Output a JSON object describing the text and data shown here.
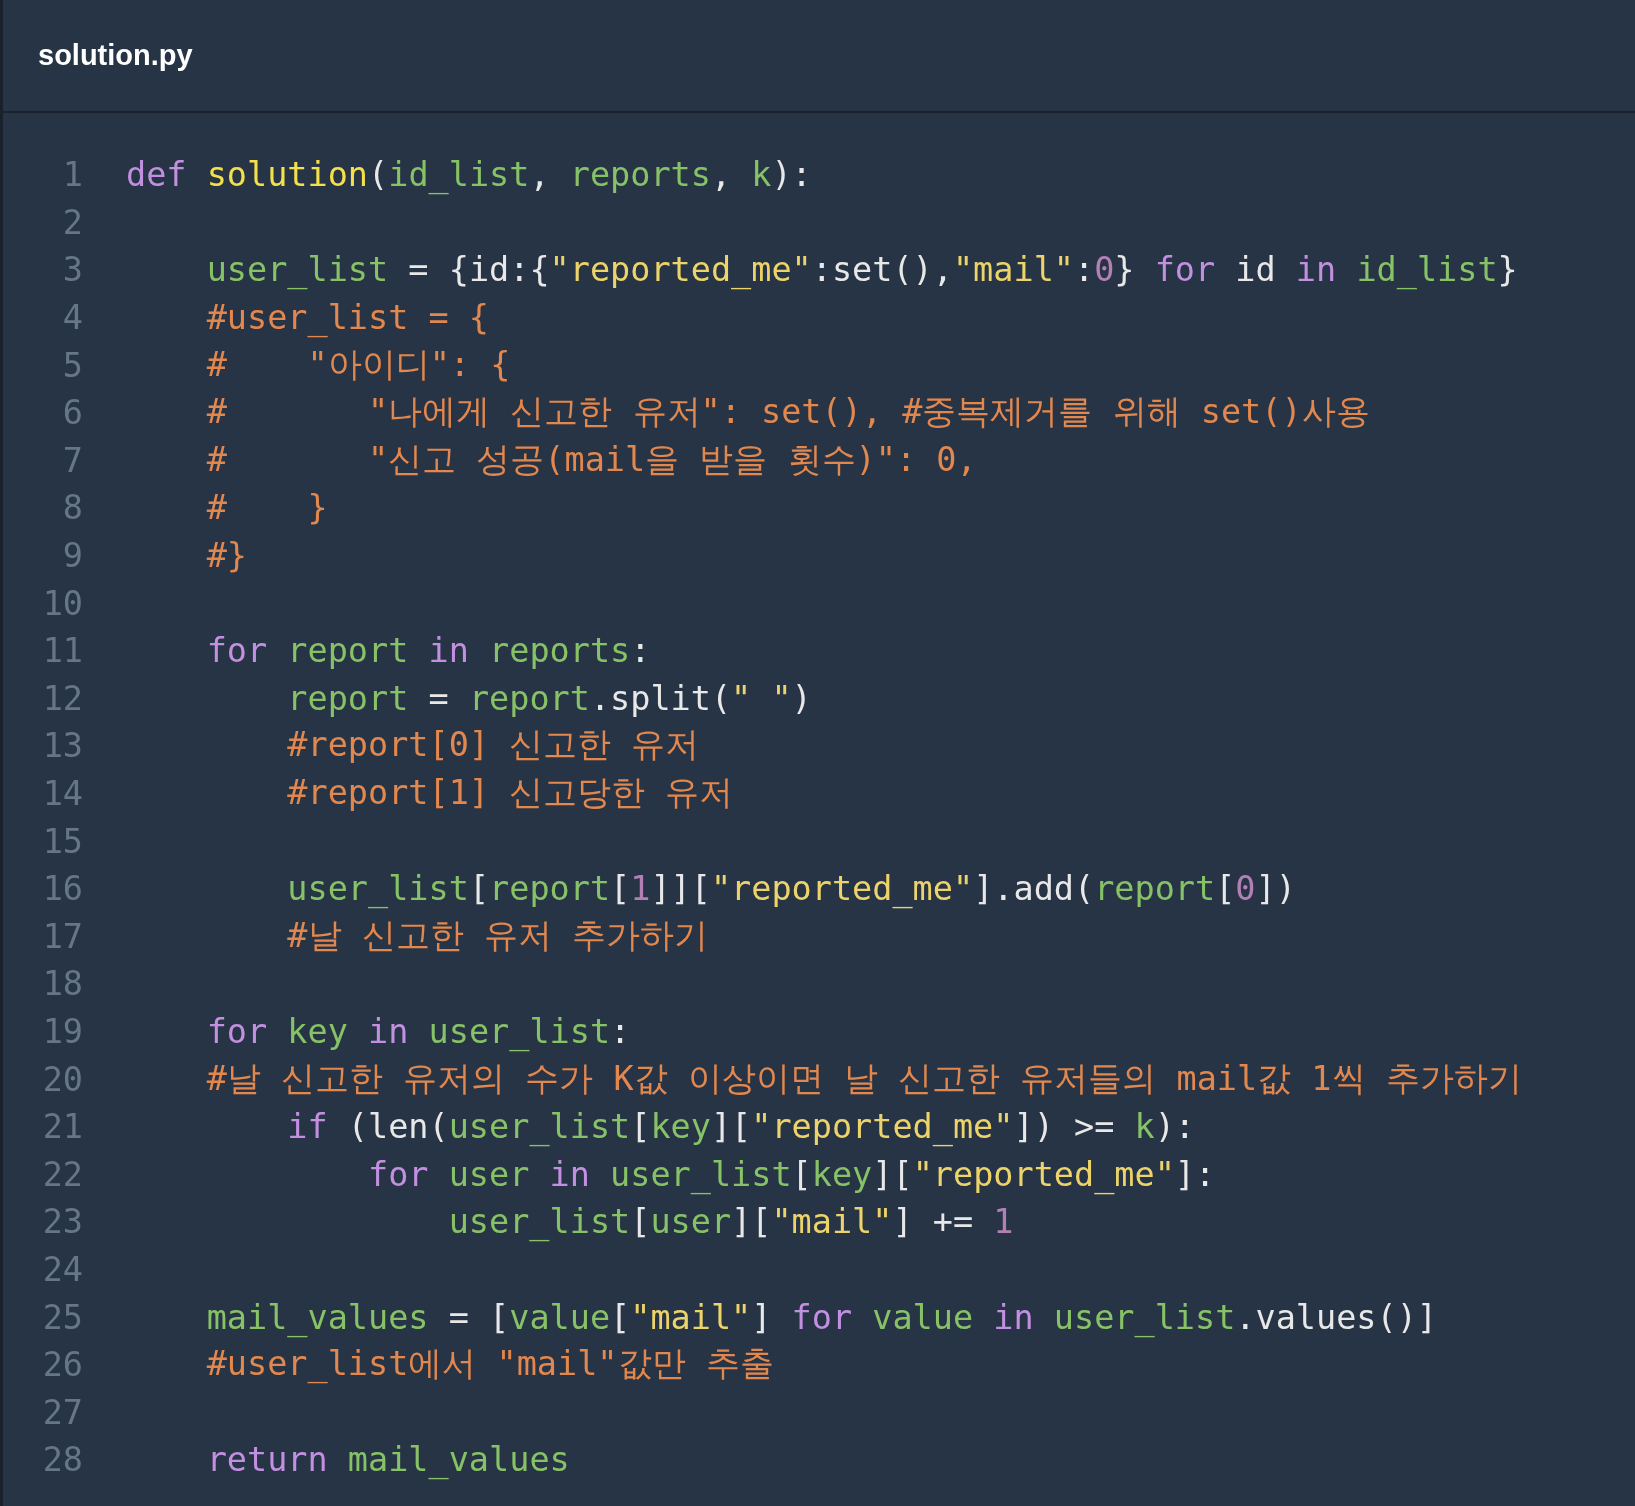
{
  "file_tab": {
    "title": "solution.py"
  },
  "lines": [
    {
      "number": "1",
      "tokens": [
        {
          "kind": "kw",
          "text": "def "
        },
        {
          "kind": "fn",
          "text": "solution"
        },
        {
          "kind": "p",
          "text": "("
        },
        {
          "kind": "var",
          "text": "id_list"
        },
        {
          "kind": "p",
          "text": ", "
        },
        {
          "kind": "var",
          "text": "reports"
        },
        {
          "kind": "p",
          "text": ", "
        },
        {
          "kind": "var",
          "text": "k"
        },
        {
          "kind": "p",
          "text": "):"
        }
      ]
    },
    {
      "number": "2"
    },
    {
      "number": "3",
      "tokens": [
        {
          "kind": "var",
          "text": "    user_list"
        },
        {
          "kind": "p",
          "text": " = {id:{"
        },
        {
          "kind": "str",
          "text": "\"reported_me\""
        },
        {
          "kind": "p",
          "text": ":set(),"
        },
        {
          "kind": "str",
          "text": "\"mail\""
        },
        {
          "kind": "p",
          "text": ":"
        },
        {
          "kind": "num",
          "text": "0"
        },
        {
          "kind": "p",
          "text": "} "
        },
        {
          "kind": "kw",
          "text": "for"
        },
        {
          "kind": "p",
          "text": " id "
        },
        {
          "kind": "kw",
          "text": "in "
        },
        {
          "kind": "var",
          "text": "id_list"
        },
        {
          "kind": "p",
          "text": "}"
        }
      ]
    },
    {
      "number": "4",
      "tokens": [
        {
          "kind": "com",
          "text": "    #user_list = {"
        }
      ]
    },
    {
      "number": "5",
      "tokens": [
        {
          "kind": "com",
          "text": "    #    \"아이디\": {"
        }
      ]
    },
    {
      "number": "6",
      "tokens": [
        {
          "kind": "com",
          "text": "    #       \"나에게 신고한 유저\": set(), #중복제거를 위해 set()사용"
        }
      ]
    },
    {
      "number": "7",
      "tokens": [
        {
          "kind": "com",
          "text": "    #       \"신고 성공(mail을 받을 횟수)\": 0,"
        }
      ]
    },
    {
      "number": "8",
      "tokens": [
        {
          "kind": "com",
          "text": "    #    }"
        }
      ]
    },
    {
      "number": "9",
      "tokens": [
        {
          "kind": "com",
          "text": "    #}"
        }
      ]
    },
    {
      "number": "10"
    },
    {
      "number": "11",
      "tokens": [
        {
          "kind": "kw",
          "text": "    for "
        },
        {
          "kind": "var",
          "text": "report "
        },
        {
          "kind": "kw",
          "text": "in "
        },
        {
          "kind": "var",
          "text": "reports"
        },
        {
          "kind": "p",
          "text": ":"
        }
      ]
    },
    {
      "number": "12",
      "tokens": [
        {
          "kind": "var",
          "text": "        report"
        },
        {
          "kind": "p",
          "text": " = "
        },
        {
          "kind": "var",
          "text": "report"
        },
        {
          "kind": "p",
          "text": ".split("
        },
        {
          "kind": "str",
          "text": "\" \""
        },
        {
          "kind": "p",
          "text": ")"
        }
      ]
    },
    {
      "number": "13",
      "tokens": [
        {
          "kind": "com",
          "text": "        #report[0] 신고한 유저"
        }
      ]
    },
    {
      "number": "14",
      "tokens": [
        {
          "kind": "com",
          "text": "        #report[1] 신고당한 유저"
        }
      ]
    },
    {
      "number": "15"
    },
    {
      "number": "16",
      "tokens": [
        {
          "kind": "var",
          "text": "        user_list"
        },
        {
          "kind": "p",
          "text": "["
        },
        {
          "kind": "var",
          "text": "report"
        },
        {
          "kind": "p",
          "text": "["
        },
        {
          "kind": "num",
          "text": "1"
        },
        {
          "kind": "p",
          "text": "]]["
        },
        {
          "kind": "str",
          "text": "\"reported_me\""
        },
        {
          "kind": "p",
          "text": "].add("
        },
        {
          "kind": "var",
          "text": "report"
        },
        {
          "kind": "p",
          "text": "["
        },
        {
          "kind": "num",
          "text": "0"
        },
        {
          "kind": "p",
          "text": "])"
        }
      ]
    },
    {
      "number": "17",
      "tokens": [
        {
          "kind": "com",
          "text": "        #날 신고한 유저 추가하기"
        }
      ]
    },
    {
      "number": "18"
    },
    {
      "number": "19",
      "tokens": [
        {
          "kind": "kw",
          "text": "    for "
        },
        {
          "kind": "var",
          "text": "key "
        },
        {
          "kind": "kw",
          "text": "in "
        },
        {
          "kind": "var",
          "text": "user_list"
        },
        {
          "kind": "p",
          "text": ":"
        }
      ]
    },
    {
      "number": "20",
      "tokens": [
        {
          "kind": "com",
          "text": "    #날 신고한 유저의 수가 K값 이상이면 날 신고한 유저들의 mail값 1씩 추가하기"
        }
      ]
    },
    {
      "number": "21",
      "tokens": [
        {
          "kind": "kw",
          "text": "        if"
        },
        {
          "kind": "p",
          "text": " (len("
        },
        {
          "kind": "var",
          "text": "user_list"
        },
        {
          "kind": "p",
          "text": "["
        },
        {
          "kind": "var",
          "text": "key"
        },
        {
          "kind": "p",
          "text": "]["
        },
        {
          "kind": "str",
          "text": "\"reported_me\""
        },
        {
          "kind": "p",
          "text": "]) >= "
        },
        {
          "kind": "var",
          "text": "k"
        },
        {
          "kind": "p",
          "text": "):"
        }
      ]
    },
    {
      "number": "22",
      "tokens": [
        {
          "kind": "kw",
          "text": "            for "
        },
        {
          "kind": "var",
          "text": "user "
        },
        {
          "kind": "kw",
          "text": "in "
        },
        {
          "kind": "var",
          "text": "user_list"
        },
        {
          "kind": "p",
          "text": "["
        },
        {
          "kind": "var",
          "text": "key"
        },
        {
          "kind": "p",
          "text": "]["
        },
        {
          "kind": "str",
          "text": "\"reported_me\""
        },
        {
          "kind": "p",
          "text": "]:"
        }
      ]
    },
    {
      "number": "23",
      "tokens": [
        {
          "kind": "var",
          "text": "                user_list"
        },
        {
          "kind": "p",
          "text": "["
        },
        {
          "kind": "var",
          "text": "user"
        },
        {
          "kind": "p",
          "text": "]["
        },
        {
          "kind": "str",
          "text": "\"mail\""
        },
        {
          "kind": "p",
          "text": "] += "
        },
        {
          "kind": "num",
          "text": "1"
        }
      ]
    },
    {
      "number": "24"
    },
    {
      "number": "25",
      "tokens": [
        {
          "kind": "var",
          "text": "    mail_values"
        },
        {
          "kind": "p",
          "text": " = ["
        },
        {
          "kind": "var",
          "text": "value"
        },
        {
          "kind": "p",
          "text": "["
        },
        {
          "kind": "str",
          "text": "\"mail\""
        },
        {
          "kind": "p",
          "text": "] "
        },
        {
          "kind": "kw",
          "text": "for "
        },
        {
          "kind": "var",
          "text": "value "
        },
        {
          "kind": "kw",
          "text": "in "
        },
        {
          "kind": "var",
          "text": "user_list"
        },
        {
          "kind": "p",
          "text": ".values()]"
        }
      ]
    },
    {
      "number": "26",
      "tokens": [
        {
          "kind": "com",
          "text": "    #user_list에서 \"mail\"값만 추출"
        }
      ]
    },
    {
      "number": "27"
    },
    {
      "number": "28",
      "tokens": [
        {
          "kind": "kw",
          "text": "    return "
        },
        {
          "kind": "var",
          "text": "mail_values"
        }
      ]
    }
  ]
}
